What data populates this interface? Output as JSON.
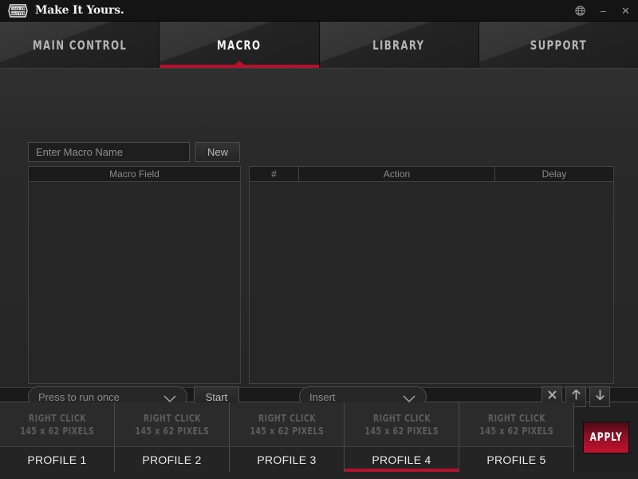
{
  "titlebar": {
    "brand": "Make It Yours.",
    "logo_icon": "cooler-master-logo-icon",
    "logo_top": "COOLER",
    "logo_bottom": "MASTER",
    "globe_icon": "globe-icon",
    "minimize_label": "–",
    "close_label": "✕"
  },
  "tabs": [
    {
      "label": "MAIN CONTROL",
      "active": false
    },
    {
      "label": "MACRO",
      "active": true
    },
    {
      "label": "LIBRARY",
      "active": false
    },
    {
      "label": "SUPPORT",
      "active": false
    }
  ],
  "macro": {
    "name_input": {
      "value": "",
      "placeholder": "Enter Macro Name"
    },
    "new_button": "New",
    "field_panel": {
      "header": "Macro Field",
      "items": []
    },
    "action_table": {
      "columns": [
        "#",
        "Action",
        "Delay"
      ],
      "rows": []
    },
    "run_mode": {
      "selected": "Press to run once",
      "chevron_icon": "chevron-down-icon"
    },
    "start_button": "Start",
    "insert_dropdown": {
      "selected": "Insert",
      "chevron_icon": "chevron-down-icon"
    },
    "row_actions": [
      {
        "name": "delete",
        "icon": "close-x-icon",
        "glyph": "✕"
      },
      {
        "name": "move-up",
        "icon": "arrow-up-icon",
        "glyph": "↑"
      },
      {
        "name": "move-down",
        "icon": "arrow-down-icon",
        "glyph": "↓"
      }
    ]
  },
  "profiles": {
    "thumb_hint_line1": "RIGHT CLICK",
    "thumb_hint_line2": "145 x 62 PIXELS",
    "items": [
      {
        "label": "PROFILE 1",
        "active": false
      },
      {
        "label": "PROFILE 2",
        "active": false
      },
      {
        "label": "PROFILE 3",
        "active": false
      },
      {
        "label": "PROFILE 4",
        "active": true
      },
      {
        "label": "PROFILE 5",
        "active": false
      }
    ],
    "apply_button": "APPLY"
  },
  "colors": {
    "accent_red": "#b4122c",
    "apply_red": "#c2132e",
    "panel_bg": "#262626",
    "text_muted": "#8b8b8b"
  }
}
